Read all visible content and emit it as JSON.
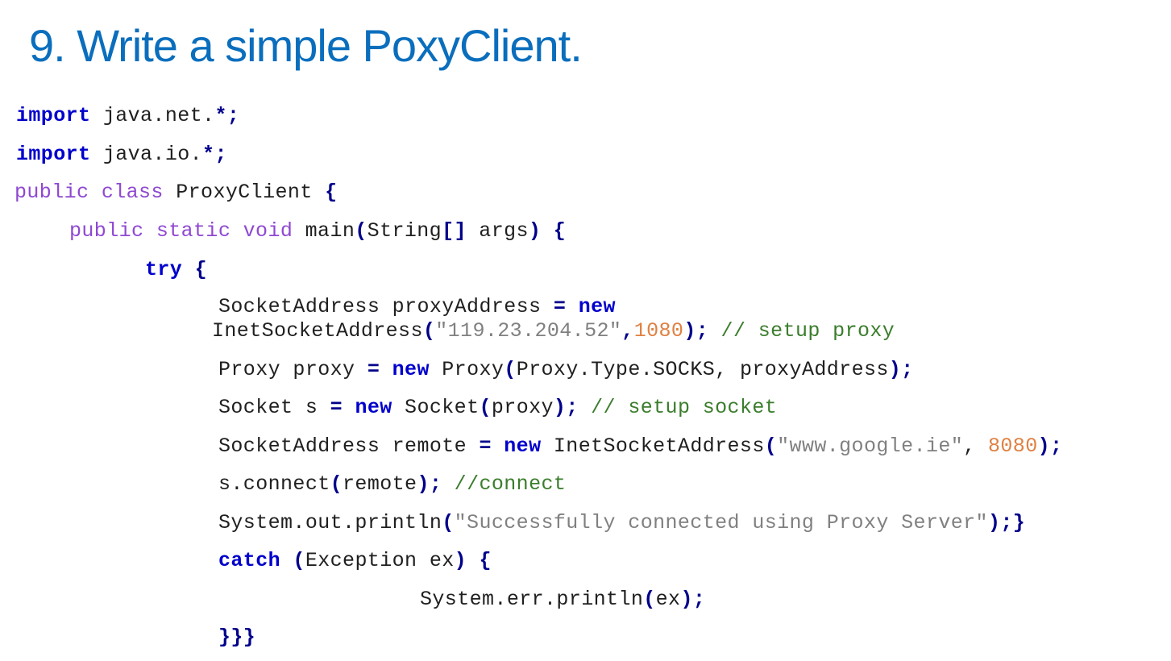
{
  "slide": {
    "title": "9.  Write a simple PoxyClient."
  },
  "code_lines": [
    [
      {
        "t": "import",
        "c": "kw"
      },
      {
        "t": " java.net.",
        "c": "plain"
      },
      {
        "t": "*;",
        "c": "op"
      }
    ],
    [
      {
        "t": "import",
        "c": "kw"
      },
      {
        "t": " java.io.",
        "c": "plain"
      },
      {
        "t": "*;",
        "c": "op"
      }
    ],
    [
      {
        "t": "public class",
        "c": "mod"
      },
      {
        "t": " ProxyClient ",
        "c": "plain"
      },
      {
        "t": "{",
        "c": "op"
      }
    ],
    [
      {
        "t": "public static void",
        "c": "mod"
      },
      {
        "t": " main",
        "c": "plain"
      },
      {
        "t": "(",
        "c": "op"
      },
      {
        "t": "String",
        "c": "plain"
      },
      {
        "t": "[]",
        "c": "op"
      },
      {
        "t": " args",
        "c": "plain"
      },
      {
        "t": ")",
        "c": "op"
      },
      {
        "t": " ",
        "c": "plain"
      },
      {
        "t": "{",
        "c": "op"
      }
    ],
    [
      {
        "t": "try",
        "c": "kw"
      },
      {
        "t": " ",
        "c": "plain"
      },
      {
        "t": "{",
        "c": "op"
      }
    ],
    [
      {
        "t": "SocketAddress proxyAddress ",
        "c": "plain"
      },
      {
        "t": "=",
        "c": "op"
      },
      {
        "t": " ",
        "c": "plain"
      },
      {
        "t": "new",
        "c": "kw"
      }
    ],
    [
      {
        "t": "InetSocketAddress",
        "c": "plain"
      },
      {
        "t": "(",
        "c": "op"
      },
      {
        "t": "\"119.23.204.52\"",
        "c": "str"
      },
      {
        "t": ",",
        "c": "op"
      },
      {
        "t": "1080",
        "c": "num"
      },
      {
        "t": ");",
        "c": "op"
      },
      {
        "t": " ",
        "c": "plain"
      },
      {
        "t": "// setup proxy",
        "c": "com"
      }
    ],
    [
      {
        "t": "Proxy proxy ",
        "c": "plain"
      },
      {
        "t": "=",
        "c": "op"
      },
      {
        "t": " ",
        "c": "plain"
      },
      {
        "t": "new",
        "c": "kw"
      },
      {
        "t": " Proxy",
        "c": "plain"
      },
      {
        "t": "(",
        "c": "op"
      },
      {
        "t": "Proxy.Type.SOCKS, proxyAddress",
        "c": "plain"
      },
      {
        "t": ");",
        "c": "op"
      }
    ],
    [
      {
        "t": "Socket s ",
        "c": "plain"
      },
      {
        "t": "=",
        "c": "op"
      },
      {
        "t": " ",
        "c": "plain"
      },
      {
        "t": "new",
        "c": "kw"
      },
      {
        "t": " Socket",
        "c": "plain"
      },
      {
        "t": "(",
        "c": "op"
      },
      {
        "t": "proxy",
        "c": "plain"
      },
      {
        "t": ");",
        "c": "op"
      },
      {
        "t": " ",
        "c": "plain"
      },
      {
        "t": "// setup socket",
        "c": "com"
      }
    ],
    [
      {
        "t": "SocketAddress remote ",
        "c": "plain"
      },
      {
        "t": "=",
        "c": "op"
      },
      {
        "t": " ",
        "c": "plain"
      },
      {
        "t": "new",
        "c": "kw"
      },
      {
        "t": " InetSocketAddress",
        "c": "plain"
      },
      {
        "t": "(",
        "c": "op"
      },
      {
        "t": "\"www.google.ie\"",
        "c": "str"
      },
      {
        "t": ", ",
        "c": "plain"
      },
      {
        "t": "8080",
        "c": "num"
      },
      {
        "t": ");",
        "c": "op"
      }
    ],
    [
      {
        "t": "s.connect",
        "c": "plain"
      },
      {
        "t": "(",
        "c": "op"
      },
      {
        "t": "remote",
        "c": "plain"
      },
      {
        "t": ");",
        "c": "op"
      },
      {
        "t": " ",
        "c": "plain"
      },
      {
        "t": "//connect",
        "c": "com"
      }
    ],
    [
      {
        "t": "System.out.println",
        "c": "plain"
      },
      {
        "t": "(",
        "c": "op"
      },
      {
        "t": "\"Successfully connected using Proxy Server\"",
        "c": "str"
      },
      {
        "t": ");}",
        "c": "op"
      }
    ],
    [
      {
        "t": "catch",
        "c": "kw"
      },
      {
        "t": " ",
        "c": "plain"
      },
      {
        "t": "(",
        "c": "op"
      },
      {
        "t": "Exception ex",
        "c": "plain"
      },
      {
        "t": ")",
        "c": "op"
      },
      {
        "t": " ",
        "c": "plain"
      },
      {
        "t": "{",
        "c": "op"
      }
    ],
    [
      {
        "t": "System.err.println",
        "c": "plain"
      },
      {
        "t": "(",
        "c": "op"
      },
      {
        "t": "ex",
        "c": "plain"
      },
      {
        "t": ");",
        "c": "op"
      }
    ],
    [
      {
        "t": "}}}",
        "c": "op"
      }
    ]
  ],
  "colors": {
    "title": "#0a6ebd",
    "keyword": "#0000cc",
    "modifier": "#8f48d2",
    "string": "#808080",
    "number": "#e08040",
    "comment": "#3a7d2c",
    "punctuation": "#00008b",
    "text": "#1f1f1f"
  }
}
